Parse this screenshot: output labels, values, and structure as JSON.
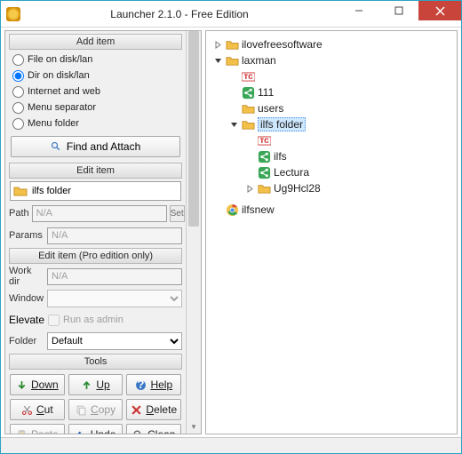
{
  "title": "Launcher 2.1.0 - Free Edition",
  "sections": {
    "add_item": "Add item",
    "edit_item": "Edit item",
    "edit_item_pro": "Edit item (Pro edition only)",
    "tools": "Tools"
  },
  "radio": {
    "file": "File on disk/lan",
    "dir": "Dir on disk/lan",
    "internet": "Internet and web",
    "sep": "Menu separator",
    "folder": "Menu folder",
    "selected": "dir"
  },
  "find_attach": "Find and Attach",
  "edit": {
    "name_value": "ilfs folder",
    "path_label": "Path",
    "path_value": "N/A",
    "set_btn": "Set",
    "params_label": "Params",
    "params_value": "N/A"
  },
  "pro": {
    "workdir_label": "Work dir",
    "workdir_value": "N/A",
    "window_label": "Window",
    "window_value": "",
    "elevate_label": "Elevate",
    "run_admin": "Run as admin",
    "folder_label": "Folder",
    "folder_value": "Default"
  },
  "tools": {
    "down": "Down",
    "up": "Up",
    "help": "Help",
    "cut": "Cut",
    "copy": "Copy",
    "delete": "Delete",
    "paste": "Paste",
    "undo": "Undo",
    "clean": "Clean"
  },
  "tree": [
    {
      "indent": 0,
      "toggle": "right",
      "icon": "folder",
      "label": "ilovefreesoftware",
      "sel": false
    },
    {
      "indent": 0,
      "toggle": "down",
      "icon": "folder",
      "label": "laxman",
      "sel": false
    },
    {
      "indent": 1,
      "toggle": "none",
      "icon": "tc",
      "label": "",
      "sel": false
    },
    {
      "indent": 1,
      "toggle": "none",
      "icon": "share",
      "label": "111",
      "sel": false
    },
    {
      "indent": 1,
      "toggle": "none",
      "icon": "folder",
      "label": "users",
      "sel": false
    },
    {
      "indent": 1,
      "toggle": "down",
      "icon": "folder",
      "label": "ilfs folder",
      "sel": true
    },
    {
      "indent": 2,
      "toggle": "none",
      "icon": "tc",
      "label": "",
      "sel": false
    },
    {
      "indent": 2,
      "toggle": "none",
      "icon": "share",
      "label": "ilfs",
      "sel": false
    },
    {
      "indent": 2,
      "toggle": "none",
      "icon": "share",
      "label": "Lectura",
      "sel": false
    },
    {
      "indent": 2,
      "toggle": "right",
      "icon": "folder",
      "label": "Ug9Hcl28",
      "sel": false
    },
    {
      "indent": 0,
      "toggle": "none-sep",
      "icon": "blank",
      "label": "",
      "sel": false
    },
    {
      "indent": 0,
      "toggle": "none",
      "icon": "chrome",
      "label": "ilfsnew",
      "sel": false
    }
  ]
}
